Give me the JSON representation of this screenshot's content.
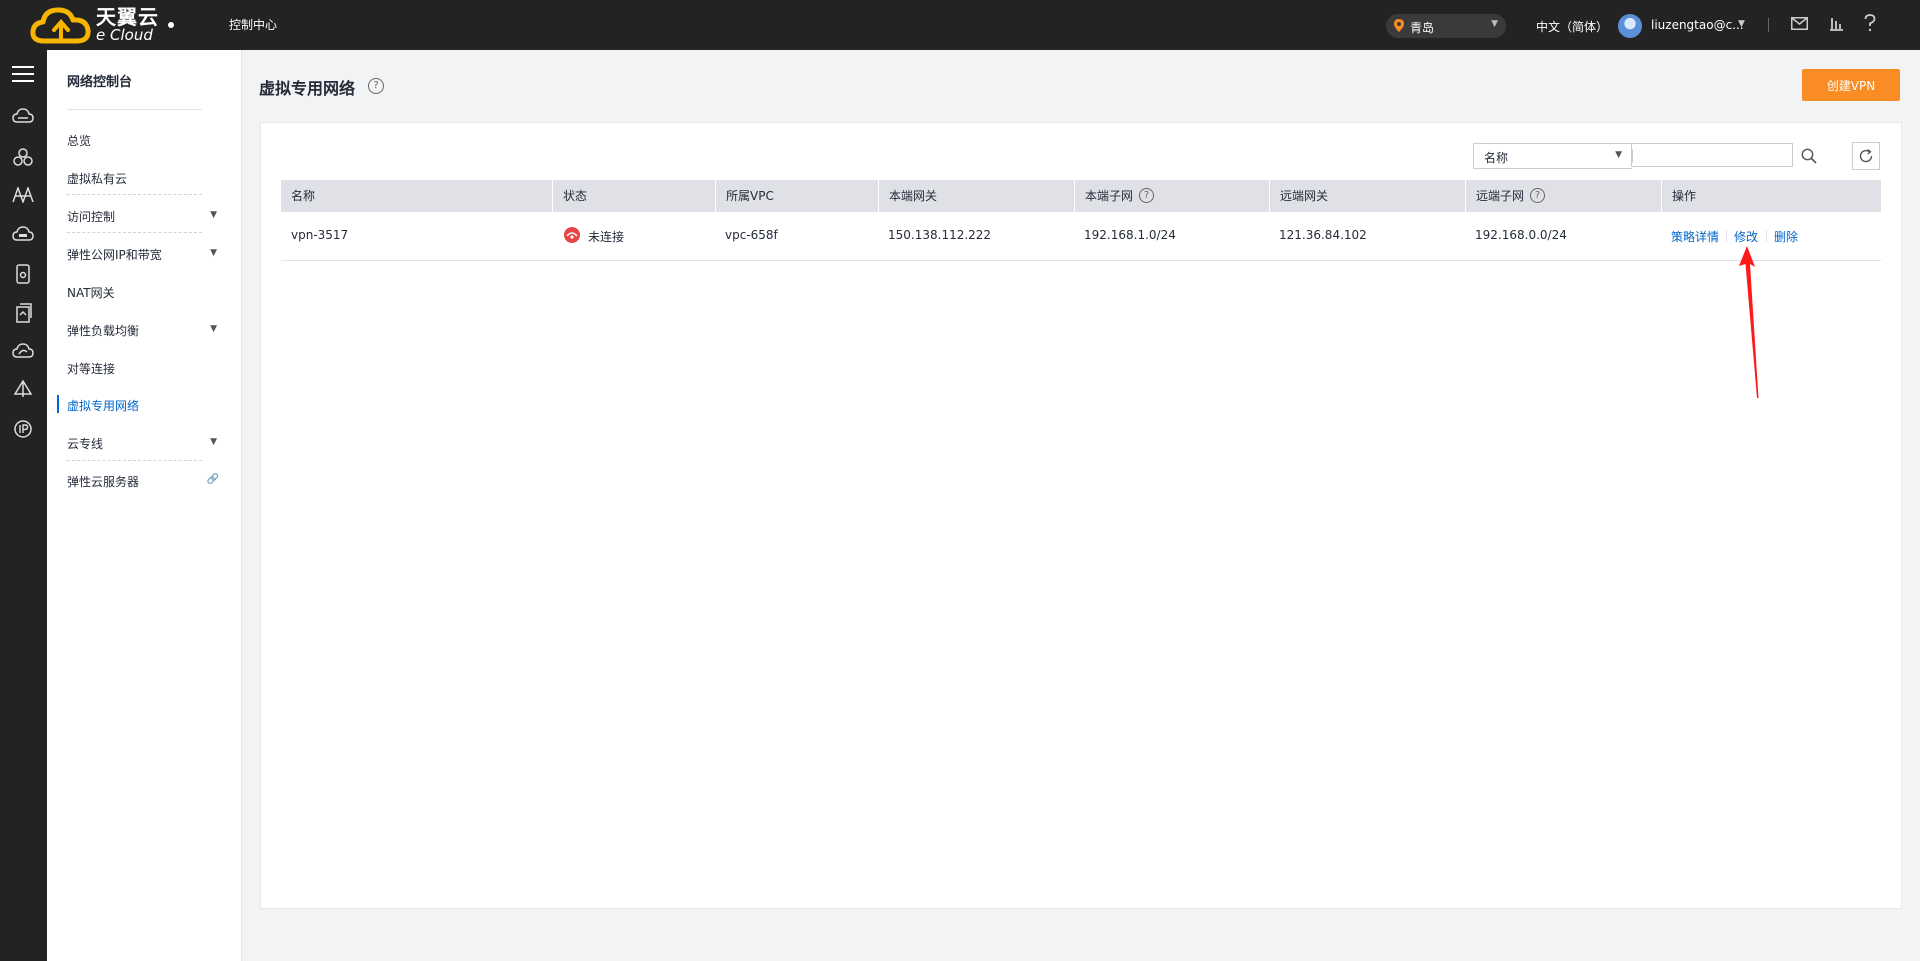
{
  "topbar": {
    "logo_cn": "天翼云",
    "logo_en": "e Cloud",
    "console_label": "控制中心",
    "region": "青岛",
    "language": "中文（简体）",
    "user": "liuzengtao@c..."
  },
  "nav": {
    "title": "网络控制台",
    "items": [
      {
        "label": "总览"
      },
      {
        "label": "虚拟私有云"
      },
      {
        "label": "访问控制"
      },
      {
        "label": "弹性公网IP和带宽"
      },
      {
        "label": "NAT网关"
      },
      {
        "label": "弹性负载均衡"
      },
      {
        "label": "对等连接"
      },
      {
        "label": "虚拟专用网络"
      },
      {
        "label": "云专线"
      },
      {
        "label": "弹性云服务器"
      }
    ]
  },
  "page": {
    "title": "虚拟专用网络",
    "create_button": "创建VPN"
  },
  "filter": {
    "selected": "名称",
    "search_value": ""
  },
  "table": {
    "columns": [
      "名称",
      "状态",
      "所属VPC",
      "本端网关",
      "本端子网",
      "远端网关",
      "远端子网",
      "操作"
    ],
    "rows": [
      {
        "name": "vpn-3517",
        "status": "未连接",
        "vpc": "vpc-658f",
        "local_gateway": "150.138.112.222",
        "local_subnet": "192.168.1.0/24",
        "remote_gateway": "121.36.84.102",
        "remote_subnet": "192.168.0.0/24",
        "actions": [
          "策略详情",
          "修改",
          "删除"
        ]
      }
    ]
  },
  "colors": {
    "topbar": "#232323",
    "accent_orange": "#fa8c24",
    "link_blue": "#0066cc",
    "status_red": "#e54545",
    "annotation_arrow": "#ff0000"
  },
  "icons": {
    "topbar": [
      "location-pin-icon",
      "mail-icon",
      "chart-icon",
      "help-icon"
    ],
    "rail": [
      "menu-icon",
      "cloud-host-icon",
      "cluster-icon",
      "cdn-icon",
      "cloud-storage-icon",
      "disk-icon",
      "backup-icon",
      "cloud-sync-icon",
      "network-icon",
      "ip-icon"
    ]
  }
}
